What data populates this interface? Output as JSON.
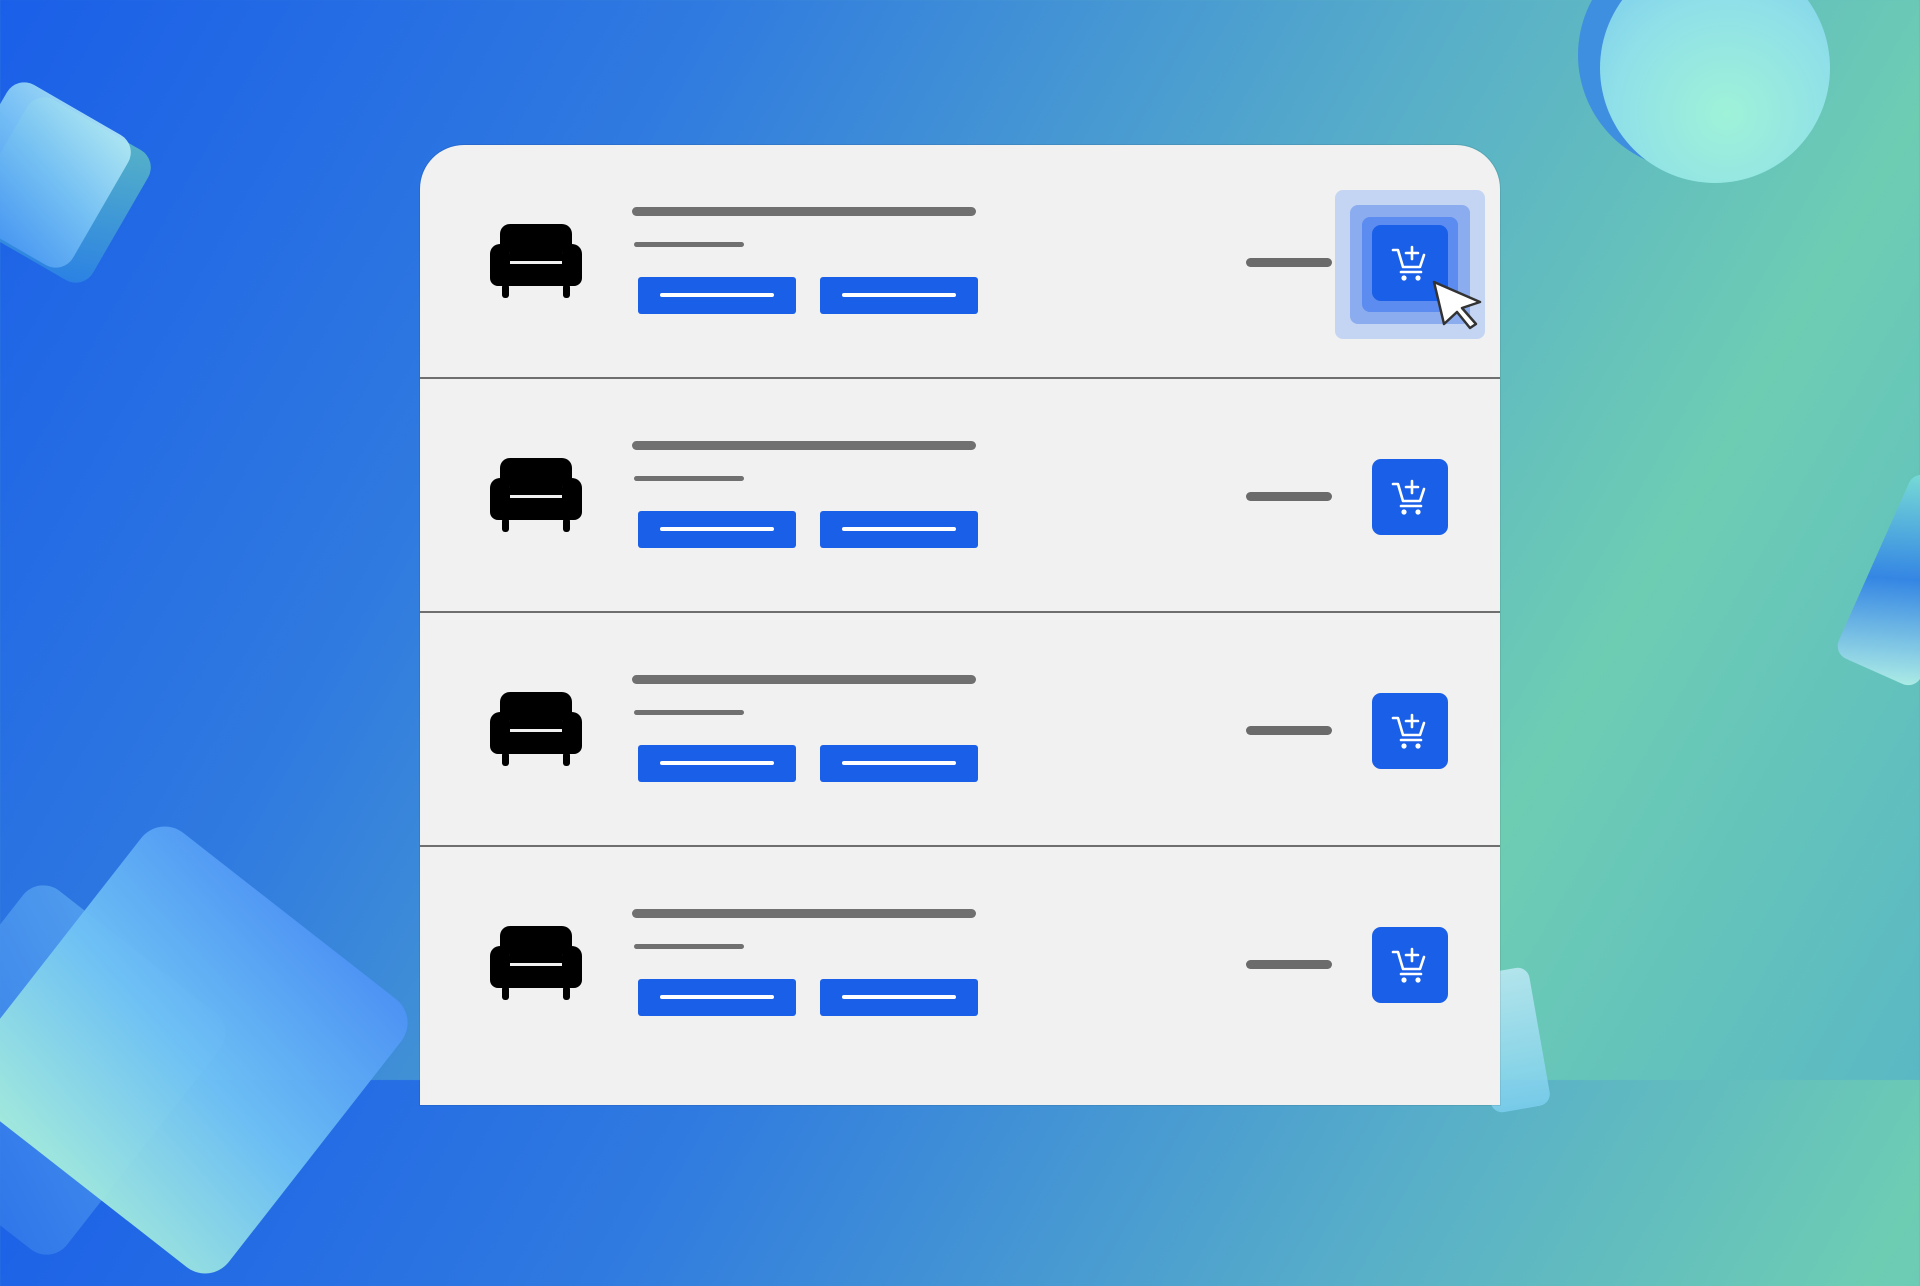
{
  "theme": {
    "accent": "#1a5fe8",
    "panel_background": "#f1f1f1",
    "placeholder_gray": "#707070"
  },
  "product_list": {
    "items": [
      {
        "icon": "armchair-icon",
        "cart_icon": "add-to-cart-icon",
        "state": "hovered"
      },
      {
        "icon": "armchair-icon",
        "cart_icon": "add-to-cart-icon",
        "state": "default"
      },
      {
        "icon": "armchair-icon",
        "cart_icon": "add-to-cart-icon",
        "state": "default"
      },
      {
        "icon": "armchair-icon",
        "cart_icon": "add-to-cart-icon",
        "state": "default"
      }
    ]
  },
  "pointer": {
    "icon": "mouse-cursor-icon",
    "over": "add-to-cart-button-1"
  }
}
